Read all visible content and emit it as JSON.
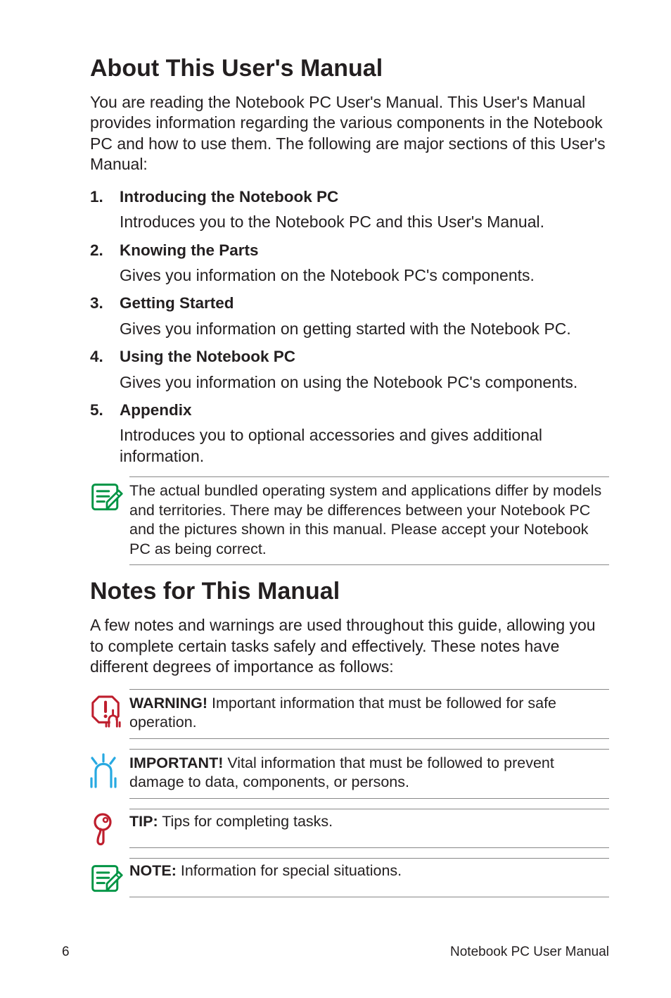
{
  "h1a": "About This User's Manual",
  "introA": "You are reading the Notebook PC User's Manual. This User's Manual provides information regarding the various components in the Notebook PC and how to use them. The following are major sections of this User's Manual:",
  "sections": [
    {
      "n": "1.",
      "title": "Introducing the Notebook PC",
      "desc": "Introduces you to the Notebook PC and this User's Manual."
    },
    {
      "n": "2.",
      "title": "Knowing the Parts",
      "desc": "Gives you information on the Notebook PC's components."
    },
    {
      "n": "3.",
      "title": "Getting Started",
      "desc": "Gives you information on getting started with the Notebook PC."
    },
    {
      "n": "4.",
      "title": "Using the Notebook PC",
      "desc": "Gives you information on using the Notebook PC's components."
    },
    {
      "n": "5.",
      "title": "Appendix",
      "desc": "Introduces you to optional accessories and gives additional information."
    }
  ],
  "noteA": "The actual bundled operating system and applications differ by models and territories. There may be differences between your Notebook PC and the pictures shown in this manual. Please accept your Notebook PC as being correct.",
  "h1b": "Notes for This Manual",
  "introB": "A few notes and warnings are used throughout this guide, allowing you to complete certain tasks safely and effectively. These notes have different degrees of importance as follows:",
  "warn_label": "WARNING!",
  "warn_text": " Important information that must be followed for safe operation.",
  "imp_label": "IMPORTANT!",
  "imp_text": " Vital information that must be followed to prevent damage to data, components, or persons.",
  "tip_label": "TIP:",
  "tip_text": " Tips for completing tasks.",
  "note_label": "NOTE:",
  "note_text": "  Information for special situations.",
  "page_number": "6",
  "footer_title": "Notebook PC User Manual",
  "icons": {
    "note": "note-icon",
    "warning": "warning-icon",
    "important": "important-icon",
    "tip": "tip-icon"
  },
  "colors": {
    "green": "#009444",
    "red": "#be1e2d",
    "blue": "#27a9e1"
  }
}
